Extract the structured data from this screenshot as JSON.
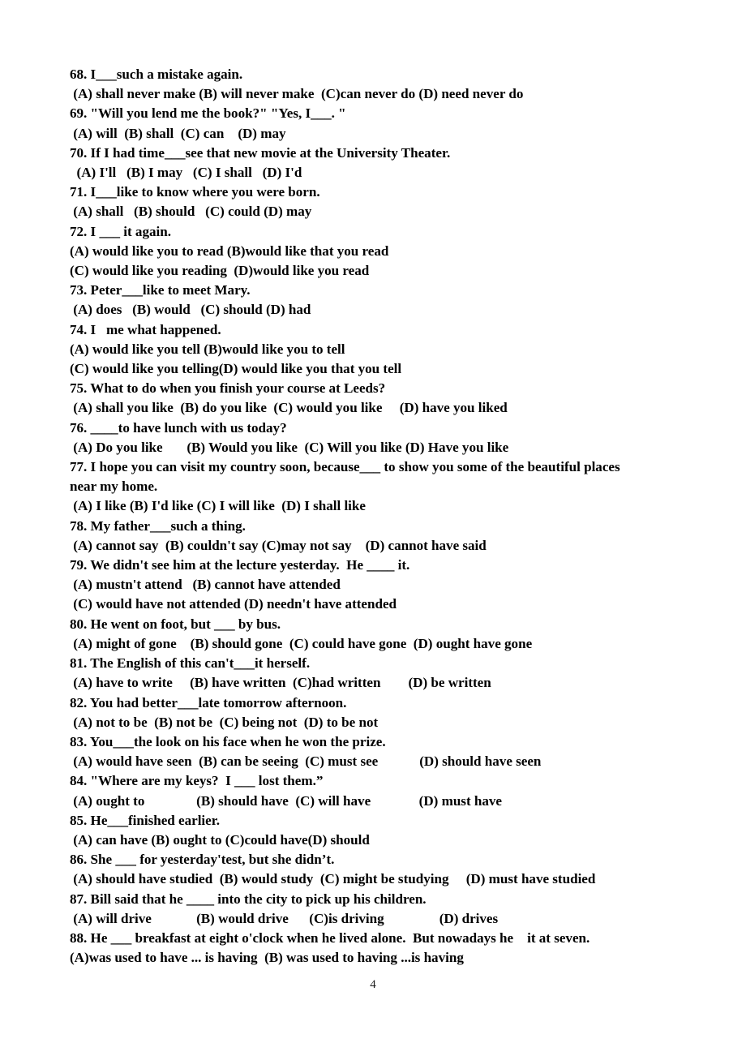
{
  "document": {
    "type": "exam-worksheet",
    "page_number": "4",
    "lines": [
      {
        "kind": "question",
        "text": "68. I___such a mistake again."
      },
      {
        "kind": "options",
        "text": " (A) shall never make (B) will never make  (C)can never do (D) need never do"
      },
      {
        "kind": "question",
        "text": "69. \"Will you lend me the book?\" \"Yes, I___. \""
      },
      {
        "kind": "options",
        "text": " (A) will  (B) shall  (C) can    (D) may"
      },
      {
        "kind": "question",
        "text": "70. If I had time___see that new movie at the University Theater."
      },
      {
        "kind": "options",
        "text": "  (A) I'll   (B) I may   (C) I shall   (D) I'd"
      },
      {
        "kind": "question",
        "text": "71. I___like to know where you were born."
      },
      {
        "kind": "options",
        "text": " (A) shall   (B) should   (C) could (D) may"
      },
      {
        "kind": "question",
        "text": "72. I ___ it again."
      },
      {
        "kind": "options",
        "text": "(A) would like you to read (B)would like that you read"
      },
      {
        "kind": "options",
        "text": "(C) would like you reading  (D)would like you read"
      },
      {
        "kind": "question",
        "text": "73. Peter___like to meet Mary."
      },
      {
        "kind": "options",
        "text": " (A) does   (B) would   (C) should (D) had"
      },
      {
        "kind": "question",
        "text": "74. I   me what happened."
      },
      {
        "kind": "options",
        "text": "(A) would like you tell (B)would like you to tell"
      },
      {
        "kind": "options",
        "text": "(C) would like you telling(D) would like you that you tell"
      },
      {
        "kind": "question",
        "text": "75. What to do when you finish your course at Leeds?"
      },
      {
        "kind": "options",
        "text": " (A) shall you like  (B) do you like  (C) would you like     (D) have you liked"
      },
      {
        "kind": "question",
        "text": "76. ____to have lunch with us today?"
      },
      {
        "kind": "options",
        "text": " (A) Do you like       (B) Would you like  (C) Will you like (D) Have you like"
      },
      {
        "kind": "question",
        "text": "77. I hope you can visit my country soon, because___ to show you some of the beautiful places"
      },
      {
        "kind": "question",
        "text": "near my home."
      },
      {
        "kind": "options",
        "text": " (A) I like (B) I'd like (C) I will like  (D) I shall like"
      },
      {
        "kind": "question",
        "text": "78. My father___such a thing."
      },
      {
        "kind": "options",
        "text": " (A) cannot say  (B) couldn't say (C)may not say    (D) cannot have said"
      },
      {
        "kind": "question",
        "text": "79. We didn't see him at the lecture yesterday.  He ____ it."
      },
      {
        "kind": "options",
        "text": " (A) mustn't attend   (B) cannot have attended"
      },
      {
        "kind": "options",
        "text": " (C) would have not attended (D) needn't have attended"
      },
      {
        "kind": "question",
        "text": "80. He went on foot, but ___ by bus."
      },
      {
        "kind": "options",
        "text": " (A) might of gone    (B) should gone  (C) could have gone  (D) ought have gone"
      },
      {
        "kind": "question",
        "text": "81. The English of this can't___it herself."
      },
      {
        "kind": "options",
        "text": " (A) have to write     (B) have written  (C)had written        (D) be written"
      },
      {
        "kind": "question",
        "text": "82. You had better___late tomorrow afternoon."
      },
      {
        "kind": "options",
        "text": " (A) not to be  (B) not be  (C) being not  (D) to be not"
      },
      {
        "kind": "question",
        "text": "83. You___the look on his face when he won the prize."
      },
      {
        "kind": "options",
        "text": " (A) would have seen  (B) can be seeing  (C) must see            (D) should have seen"
      },
      {
        "kind": "question",
        "text": "84. \"Where are my keys?  I ___ lost them.”"
      },
      {
        "kind": "options",
        "text": " (A) ought to               (B) should have  (C) will have              (D) must have"
      },
      {
        "kind": "question",
        "text": "85. He___finished earlier."
      },
      {
        "kind": "options",
        "text": " (A) can have (B) ought to (C)could have(D) should"
      },
      {
        "kind": "question",
        "text": "86. She ___ for yesterday'test, but she didn’t."
      },
      {
        "kind": "options",
        "text": " (A) should have studied  (B) would study  (C) might be studying     (D) must have studied"
      },
      {
        "kind": "question",
        "text": "87. Bill said that he ____ into the city to pick up his children."
      },
      {
        "kind": "options",
        "text": " (A) will drive             (B) would drive      (C)is driving                (D) drives"
      },
      {
        "kind": "question",
        "text": "88. He ___ breakfast at eight o'clock when he lived alone.  But nowadays he    it at seven."
      },
      {
        "kind": "options",
        "text": "(A)was used to have ... is having  (B) was used to having ...is having"
      }
    ]
  }
}
